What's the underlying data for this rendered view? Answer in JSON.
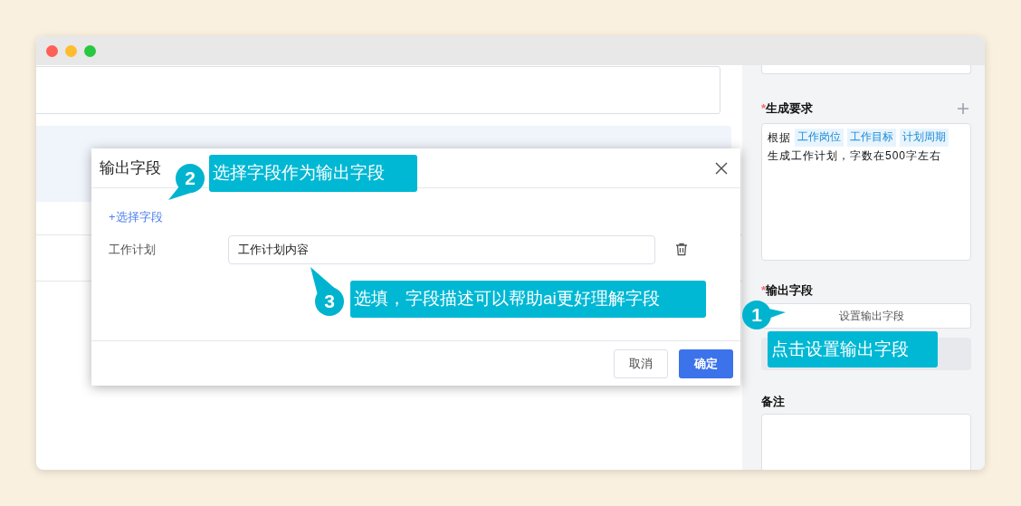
{
  "modal": {
    "title": "输出字段",
    "add_field": "+选择字段",
    "fields": [
      {
        "label": "工作计划",
        "value": "工作计划内容"
      }
    ],
    "buttons": [
      {
        "label": "取消",
        "kind": "secondary"
      },
      {
        "label": "确定",
        "kind": "primary"
      }
    ]
  },
  "sidebar": {
    "generation": {
      "marker": "*",
      "label": "生成要求",
      "content": [
        {
          "kind": "text",
          "text": "根据"
        },
        {
          "kind": "tag",
          "text": "工作岗位"
        },
        {
          "kind": "tag",
          "text": "工作目标"
        },
        {
          "kind": "tag",
          "text": "计划周期"
        },
        {
          "kind": "text",
          "text": "生成工作计划，字数在500字左右"
        }
      ]
    },
    "output": {
      "marker": "*",
      "label": "输出字段",
      "button": "设置输出字段"
    },
    "notes": {
      "label": "备注"
    }
  },
  "annotations": [
    {
      "number": "1",
      "text": "点击设置输出字段"
    },
    {
      "number": "2",
      "text": "选择字段作为输出字段"
    },
    {
      "number": "3",
      "text": "选填，字段描述可以帮助ai更好理解字段"
    }
  ]
}
